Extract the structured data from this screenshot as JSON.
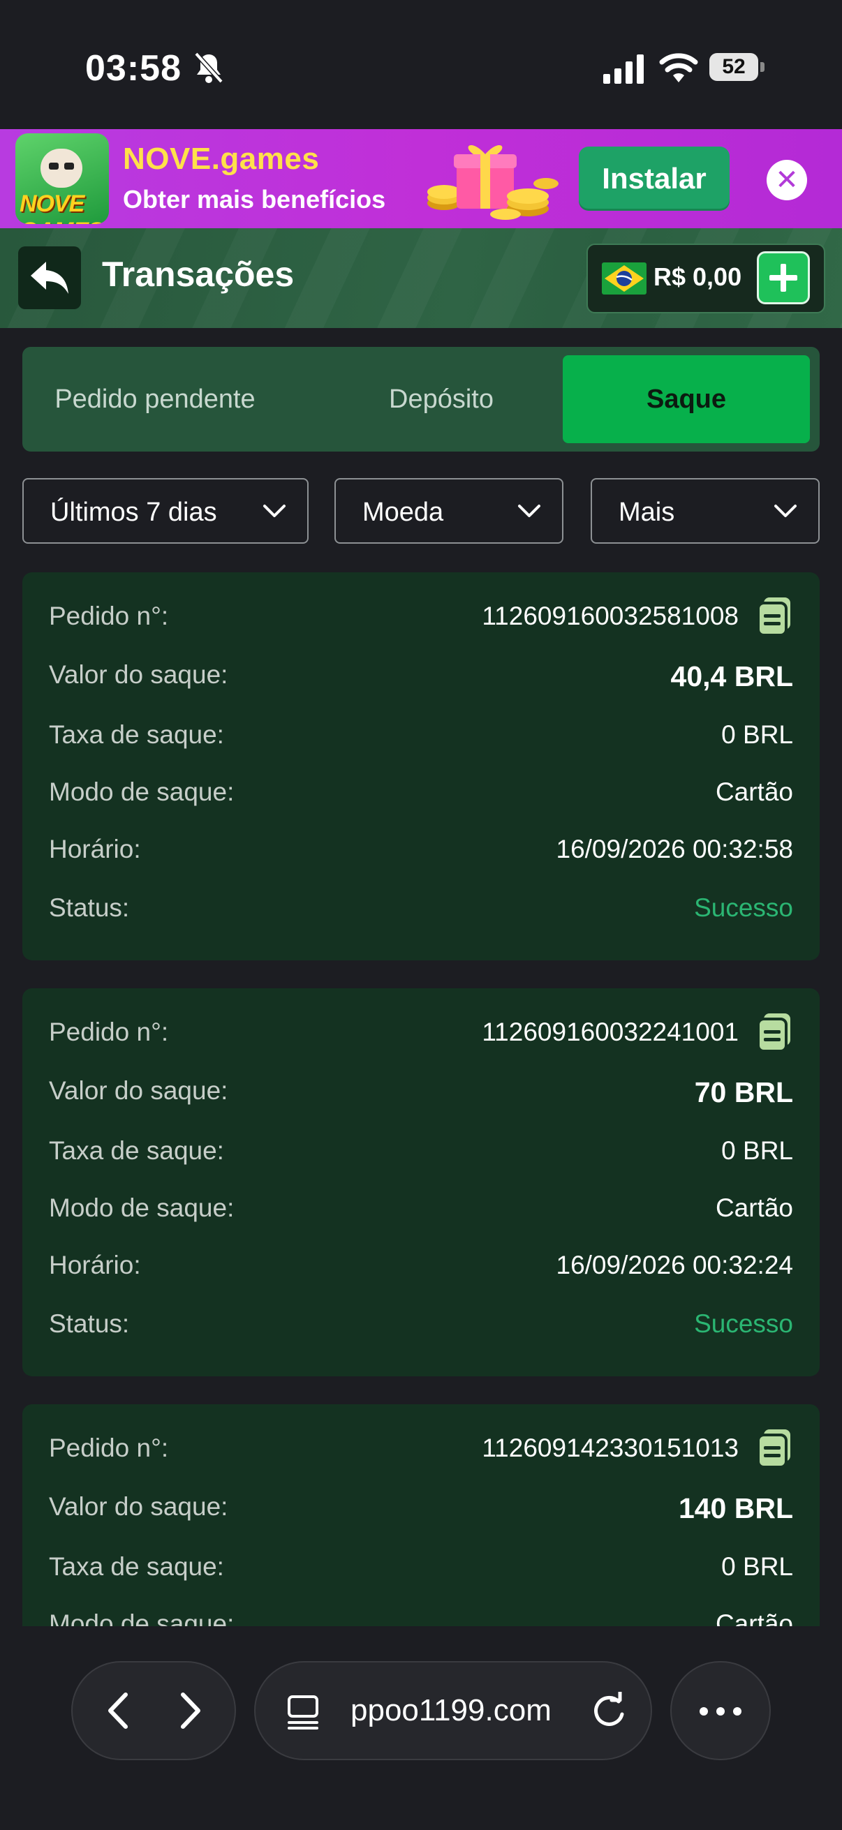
{
  "status_bar": {
    "time": "03:58",
    "battery": "52"
  },
  "promo": {
    "logo_text": "NOVE GAMES",
    "title": "NOVE.games",
    "subtitle": "Obter mais benefícios",
    "install_label": "Instalar",
    "close_icon": "✕"
  },
  "header": {
    "title": "Transações",
    "balance": "R$ 0,00"
  },
  "tabs": [
    {
      "label": "Pedido pendente"
    },
    {
      "label": "Depósito"
    },
    {
      "label": "Saque",
      "active": true
    }
  ],
  "filters": [
    {
      "label": "Últimos 7 dias"
    },
    {
      "label": "Moeda"
    },
    {
      "label": "Mais"
    }
  ],
  "row_labels": {
    "order": "Pedido n°:",
    "amount": "Valor do saque:",
    "fee": "Taxa de saque:",
    "mode": "Modo de saque:",
    "time": "Horário:",
    "status": "Status:"
  },
  "transactions": [
    {
      "order": "112609160032581008",
      "amount": "40,4 BRL",
      "fee": "0 BRL",
      "mode": "Cartão",
      "time": "16/09/2026 00:32:58",
      "status": "Sucesso"
    },
    {
      "order": "112609160032241001",
      "amount": "70 BRL",
      "fee": "0 BRL",
      "mode": "Cartão",
      "time": "16/09/2026 00:32:24",
      "status": "Sucesso"
    },
    {
      "order": "112609142330151013",
      "amount": "140 BRL",
      "fee": "0 BRL",
      "mode": "Cartão",
      "time": "",
      "status": ""
    }
  ],
  "browser": {
    "url": "ppoo1199.com"
  },
  "colors": {
    "accent_green": "#07b04b",
    "success": "#2bb673",
    "promo_purple": "#c02fd8"
  }
}
